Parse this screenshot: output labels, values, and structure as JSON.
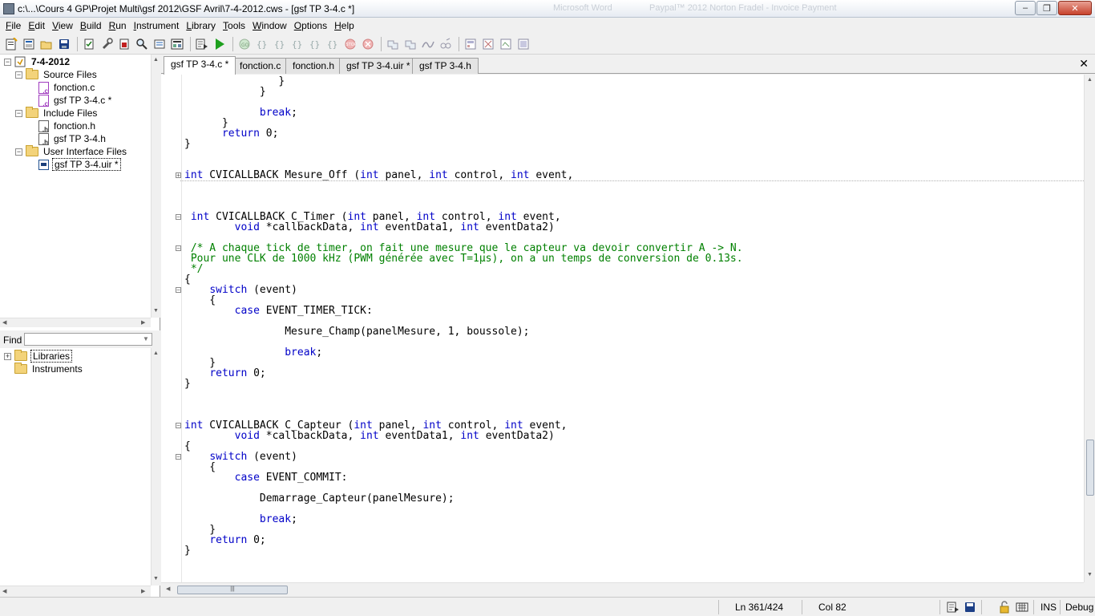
{
  "window": {
    "title": "c:\\...\\Cours 4 GP\\Projet Multi\\gsf 2012\\GSF Avril\\7-4-2012.cws - [gsf TP 3-4.c *]",
    "ghost_titles": [
      "Microsoft Word",
      "Paypal™ 2012 Norton Fradel - Invoice Payment"
    ],
    "buttons": {
      "minimize": "–",
      "restore": "❐",
      "close": "✕"
    }
  },
  "menu": [
    {
      "label": "File",
      "key": "F"
    },
    {
      "label": "Edit",
      "key": "E"
    },
    {
      "label": "View",
      "key": "V"
    },
    {
      "label": "Build",
      "key": "B"
    },
    {
      "label": "Run",
      "key": "R"
    },
    {
      "label": "Instrument",
      "key": "I"
    },
    {
      "label": "Library",
      "key": "L"
    },
    {
      "label": "Tools",
      "key": "T"
    },
    {
      "label": "Window",
      "key": "W"
    },
    {
      "label": "Options",
      "key": "O"
    },
    {
      "label": "Help",
      "key": "H"
    }
  ],
  "toolbar": {
    "icons": [
      "new-project-icon",
      "new-file-icon",
      "open-icon",
      "save-icon",
      "compile-icon",
      "build-icon",
      "stop-icon",
      "find-icon",
      "replace-icon",
      "function-panel-icon",
      "run-icon",
      "go-icon",
      "step-over-icon",
      "step-into-icon",
      "step-out-icon",
      "finish-icon",
      "stop-debug-icon",
      "terminate-icon",
      "watch-icon",
      "variables-icon",
      "breakpoint-icon",
      "memory-icon",
      "ui-editor-icon",
      "ui-code-icon",
      "ui-clear-icon",
      "ui-operate-icon"
    ]
  },
  "project_tree": {
    "workspace": "7-4-2012",
    "folders": [
      {
        "label": "Source Files",
        "files": [
          {
            "label": "fonction.c",
            "type": "c"
          },
          {
            "label": "gsf TP 3-4.c *",
            "type": "c"
          }
        ]
      },
      {
        "label": "Include Files",
        "files": [
          {
            "label": "fonction.h",
            "type": "h"
          },
          {
            "label": "gsf TP 3-4.h",
            "type": "h"
          }
        ]
      },
      {
        "label": "User Interface Files",
        "files": [
          {
            "label": "gsf TP 3-4.uir *",
            "type": "uir"
          }
        ]
      }
    ]
  },
  "find": {
    "label": "Find",
    "value": ""
  },
  "library_tree": [
    "Libraries",
    "Instruments"
  ],
  "tabs": [
    "gsf TP 3-4.c *",
    "fonction.c",
    "fonction.h",
    "gsf TP 3-4.uir *",
    "gsf TP 3-4.h"
  ],
  "active_tab": 0,
  "code": [
    {
      "t": "               }"
    },
    {
      "t": "            }"
    },
    {
      "t": ""
    },
    {
      "t": "            break;",
      "kw": [
        "break"
      ]
    },
    {
      "t": "      }"
    },
    {
      "t": "      return 0;",
      "kw": [
        "return"
      ]
    },
    {
      "t": "}"
    },
    {
      "t": ""
    },
    {
      "t": ""
    },
    {
      "t": "int CVICALLBACK Mesure_Off (int panel, int control, int event,",
      "kw": [
        "int"
      ],
      "fold": "plus",
      "collapsed": true
    },
    {
      "t": ""
    },
    {
      "t": ""
    },
    {
      "t": ""
    },
    {
      "t": " int CVICALLBACK C_Timer (int panel, int control, int event,",
      "kw": [
        "int"
      ],
      "fold": "minus"
    },
    {
      "t": "        void *callbackData, int eventData1, int eventData2)",
      "kw": [
        "void",
        "int"
      ]
    },
    {
      "t": ""
    },
    {
      "t": " /* A chaque tick de timer, on fait une mesure que le capteur va devoir convertir A -> N.",
      "cm": true,
      "fold": "minus"
    },
    {
      "t": " Pour une CLK de 1000 kHz (PWM générée avec T=1µs), on a un temps de conversion de 0.13s.",
      "cm": true
    },
    {
      "t": " */",
      "cm": true
    },
    {
      "t": "{"
    },
    {
      "t": "    switch (event)",
      "kw": [
        "switch"
      ],
      "fold": "minus"
    },
    {
      "t": "    {"
    },
    {
      "t": "        case EVENT_TIMER_TICK:",
      "kw": [
        "case"
      ]
    },
    {
      "t": ""
    },
    {
      "t": "                Mesure_Champ(panelMesure, 1, boussole);"
    },
    {
      "t": ""
    },
    {
      "t": "                break;",
      "kw": [
        "break"
      ]
    },
    {
      "t": "    }"
    },
    {
      "t": "    return 0;",
      "kw": [
        "return"
      ]
    },
    {
      "t": "}"
    },
    {
      "t": ""
    },
    {
      "t": ""
    },
    {
      "t": ""
    },
    {
      "t": "int CVICALLBACK C_Capteur (int panel, int control, int event,",
      "kw": [
        "int"
      ],
      "fold": "minus"
    },
    {
      "t": "        void *callbackData, int eventData1, int eventData2)",
      "kw": [
        "void",
        "int"
      ]
    },
    {
      "t": "{"
    },
    {
      "t": "    switch (event)",
      "kw": [
        "switch"
      ],
      "fold": "minus"
    },
    {
      "t": "    {"
    },
    {
      "t": "        case EVENT_COMMIT:",
      "kw": [
        "case"
      ]
    },
    {
      "t": ""
    },
    {
      "t": "            Demarrage_Capteur(panelMesure);"
    },
    {
      "t": ""
    },
    {
      "t": "            break;",
      "kw": [
        "break"
      ]
    },
    {
      "t": "    }"
    },
    {
      "t": "    return 0;",
      "kw": [
        "return"
      ]
    },
    {
      "t": "}"
    }
  ],
  "status": {
    "position": "Ln 361/424",
    "column": "Col 82",
    "mode": "INS",
    "config": "Debug"
  }
}
